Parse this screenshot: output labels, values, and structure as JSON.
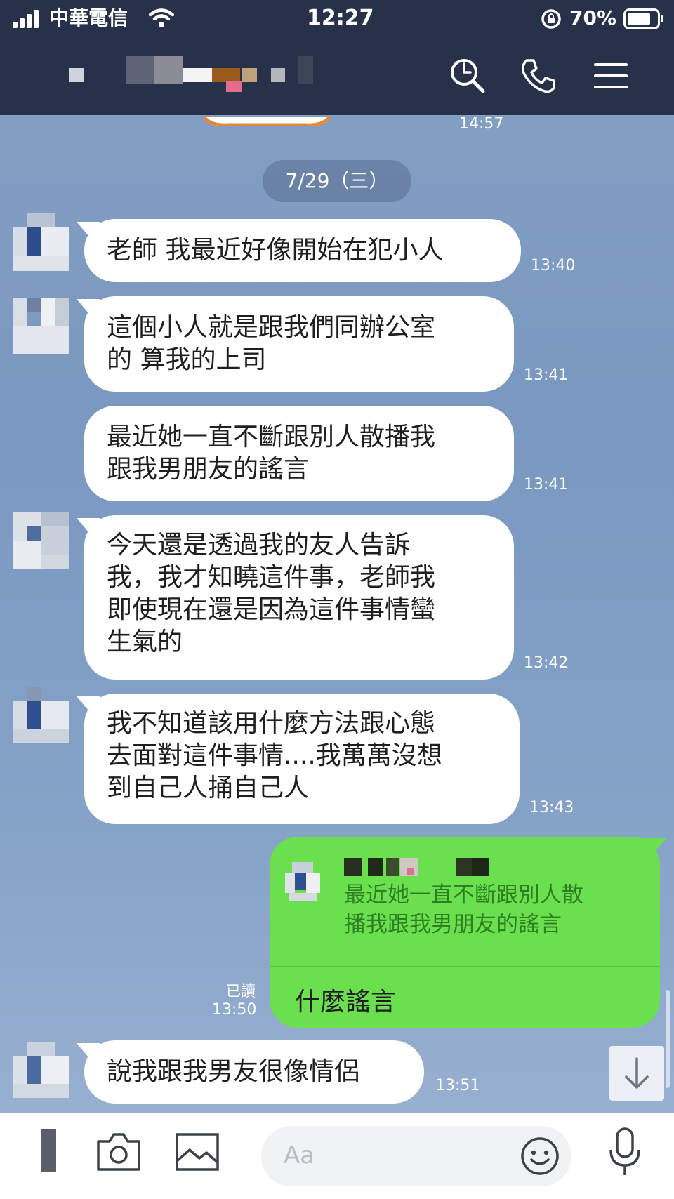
{
  "status_bar": {
    "carrier": "中華電信",
    "time": "12:27",
    "battery": "70%"
  },
  "chat": {
    "prev_time": "14:57",
    "date_divider": "7/29（三）",
    "messages": [
      {
        "text": "老師 我最近好像開始在犯小人",
        "time": "13:40"
      },
      {
        "text": "這個小人就是跟我們同辦公室\n的 算我的上司",
        "time": "13:41"
      },
      {
        "text": "最近她一直不斷跟別人散播我\n跟我男朋友的謠言",
        "time": "13:41"
      },
      {
        "text": "今天還是透過我的友人告訴\n我，我才知曉這件事，老師我\n即使現在還是因為這件事情蠻\n生氣的",
        "time": "13:42"
      },
      {
        "text": "我不知道該用什麼方法跟心態\n去面對這件事情....我萬萬沒想\n到自己人捅自己人",
        "time": "13:43"
      },
      {
        "text": "說我跟我男友很像情侶",
        "time": "13:51"
      }
    ],
    "outgoing": {
      "quote_text": "最近她一直不斷跟別人散\n播我跟我男朋友的謠言",
      "reply_text": "什麼謠言",
      "read_label": "已讀",
      "time": "13:50"
    }
  },
  "input": {
    "placeholder": "Aa"
  },
  "colors": {
    "header": "#27324a",
    "outgoing_bubble": "#6be04f",
    "chat_bg": "#7a98c0"
  },
  "icons": [
    "signal-icon",
    "wifi-icon",
    "rotation-lock-icon",
    "battery-icon",
    "search-icon",
    "phone-icon",
    "menu-icon",
    "camera-icon",
    "image-icon",
    "emoji-icon",
    "microphone-icon",
    "scroll-down-icon"
  ]
}
